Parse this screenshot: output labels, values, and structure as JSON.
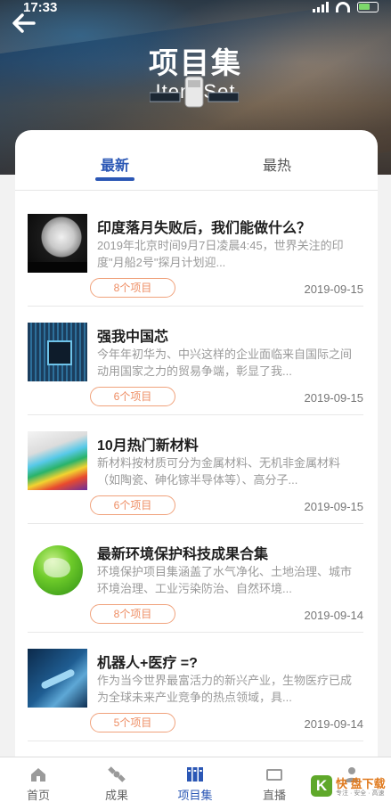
{
  "status_bar": {
    "time": "17:33"
  },
  "header": {
    "title": "项目集",
    "subtitle": "Item Set"
  },
  "tabs": [
    {
      "label": "最新",
      "active": true
    },
    {
      "label": "最热",
      "active": false
    }
  ],
  "items": [
    {
      "title": "印度落月失败后，我们能做什么？",
      "desc": "2019年北京时间9月7日凌晨4:45，世界关注的印度\"月船2号\"探月计划迎...",
      "badge": "8个项目",
      "date": "2019-09-15",
      "thumb": "moon-image"
    },
    {
      "title": "强我中国芯",
      "desc": "今年年初华为、中兴这样的企业面临来自国际之间动用国家之力的贸易争端，彰显了我...",
      "badge": "6个项目",
      "date": "2019-09-15",
      "thumb": "chip-image"
    },
    {
      "title": "10月热门新材料",
      "desc": "新材料按材质可分为金属材料、无机非金属材料（如陶瓷、砷化镓半导体等）、高分子...",
      "badge": "6个项目",
      "date": "2019-09-15",
      "thumb": "material-image"
    },
    {
      "title": "最新环境保护科技成果合集",
      "desc": "环境保护项目集涵盖了水气净化、土地治理、城市环境治理、工业污染防治、自然环境...",
      "badge": "8个项目",
      "date": "2019-09-14",
      "thumb": "globe-image"
    },
    {
      "title": "机器人+医疗 =?",
      "desc": "作为当今世界最富活力的新兴产业，生物医疗已成为全球未来产业竞争的热点领域，具...",
      "badge": "5个项目",
      "date": "2019-09-14",
      "thumb": "robot-medical-image"
    }
  ],
  "bottom_nav": [
    {
      "label": "首页",
      "icon": "home-icon",
      "active": false
    },
    {
      "label": "成果",
      "icon": "satellite-icon",
      "active": false
    },
    {
      "label": "项目集",
      "icon": "books-icon",
      "active": true
    },
    {
      "label": "直播",
      "icon": "tv-icon",
      "active": false
    },
    {
      "label": "",
      "icon": "person-icon",
      "active": false
    }
  ],
  "watermark": {
    "logo": "K",
    "text": "快 盘下载",
    "sub": "专注 · 安全 · 高速"
  },
  "colors": {
    "accent": "#2b57b5",
    "badge": "#ee8d63",
    "battery": "#7dd96b"
  }
}
